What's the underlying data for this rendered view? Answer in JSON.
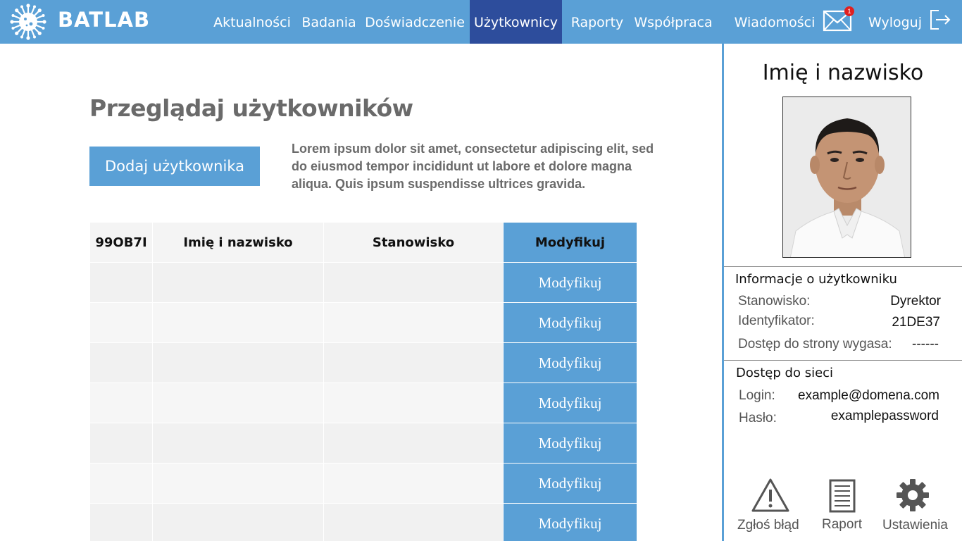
{
  "brand": {
    "name": "BATLAB"
  },
  "nav": {
    "items": [
      {
        "label": "Aktualności"
      },
      {
        "label": "Badania"
      },
      {
        "label": "Doświadczenie"
      },
      {
        "label": "Użytkownicy"
      },
      {
        "label": "Raporty"
      },
      {
        "label": "Współpraca"
      },
      {
        "label": "Wiadomości"
      },
      {
        "label": "Wyloguj"
      }
    ],
    "active": "Użytkownicy",
    "unread_count": "1"
  },
  "main": {
    "title": "Przeglądaj użytkowników",
    "add_button": "Dodaj użytkownika",
    "description": "Lorem ipsum dolor sit amet, consectetur adipiscing elit, sed do eiusmod tempor incididunt ut labore et dolore magna aliqua. Quis ipsum suspendisse ultrices gravida.",
    "table": {
      "headers": [
        "99OB7I",
        "Imię i nazwisko",
        "Stanowisko"
      ],
      "modify_label": "Modyfikuj"
    }
  },
  "sidebar": {
    "name": "Imię i nazwisko",
    "info_title": "Informacje o użytkowniku",
    "position_label": "Stanowisko:",
    "position_value": "Dyrektor",
    "id_label": "Identyfikator:",
    "id_value": "21DE37",
    "expiry_label": "Dostęp do strony wygasa:",
    "expiry_value": "------",
    "network_title": "Dostęp do sieci",
    "login_label": "Login:",
    "login_value": "example@domena.com",
    "password_label": "Hasło:",
    "password_value": "examplepassword",
    "actions": [
      {
        "label": "Zgłoś błąd",
        "icon": "warning-icon"
      },
      {
        "label": "Raport",
        "icon": "document-icon"
      },
      {
        "label": "Ustawienia",
        "icon": "gear-icon"
      }
    ]
  },
  "colors": {
    "accent": "#5aa0d6",
    "nav_active": "#2d4d9c",
    "badge": "#e02020"
  }
}
